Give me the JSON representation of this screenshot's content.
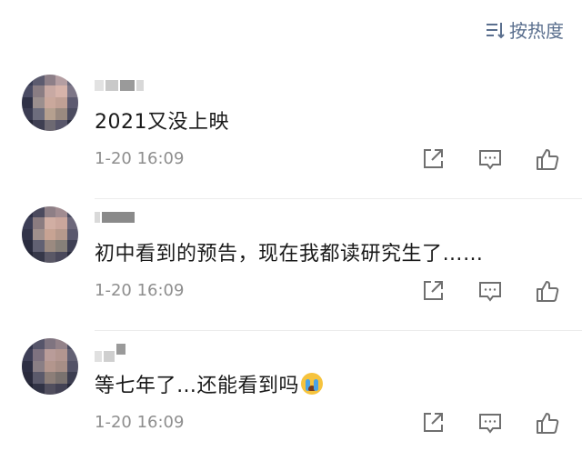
{
  "header": {
    "sort_label": "按热度"
  },
  "comments": [
    {
      "text": "2021又没上映",
      "time": "1-20 16:09"
    },
    {
      "text": "初中看到的预告，现在我都读研究生了……",
      "time": "1-20 16:09"
    },
    {
      "text": "等七年了…还能看到吗",
      "emoji": "crying-face",
      "time": "1-20 16:09"
    }
  ],
  "colors": {
    "accent": "#5a6f8e",
    "meta": "#8e8e8e",
    "icon": "#6f6f6f"
  }
}
